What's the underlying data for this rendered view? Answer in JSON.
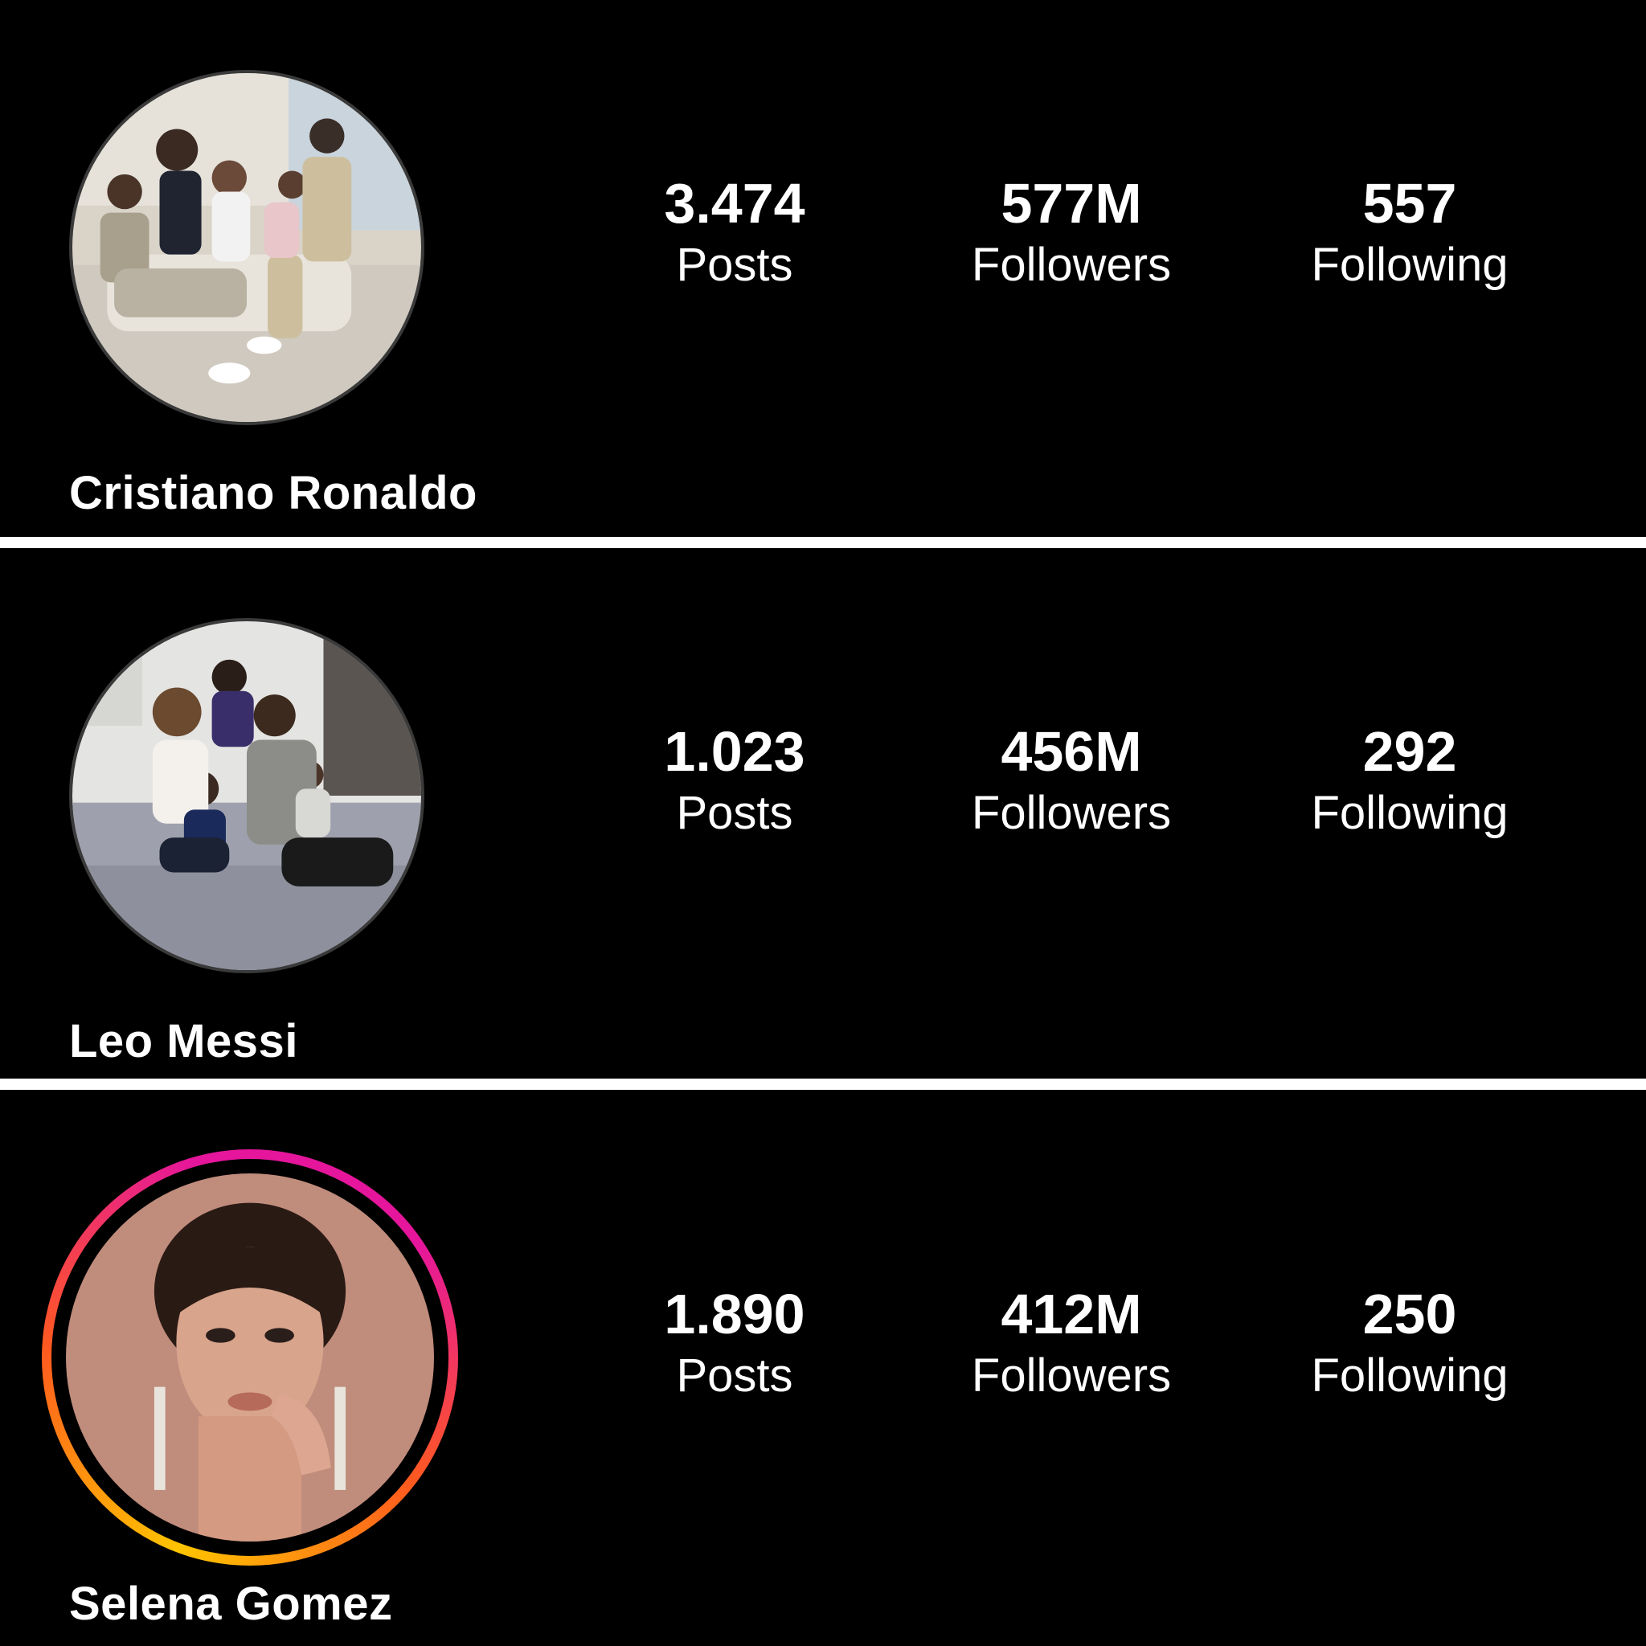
{
  "colors": {
    "background": "#000000",
    "text": "#ffffff",
    "divider": "#ffffff",
    "story_ring_start": "#ffc400",
    "story_ring_mid": "#ff5a1f",
    "story_ring_end": "#e5169c"
  },
  "profiles": [
    {
      "name": "Cristiano Ronaldo",
      "avatar_icon": "family-photo-avatar",
      "has_story_ring": false,
      "stats": {
        "posts_value": "3.474",
        "posts_label": "Posts",
        "followers_value": "577M",
        "followers_label": "Followers",
        "following_value": "557",
        "following_label": "Following"
      }
    },
    {
      "name": "Leo Messi",
      "avatar_icon": "family-photo-avatar",
      "has_story_ring": false,
      "stats": {
        "posts_value": "1.023",
        "posts_label": "Posts",
        "followers_value": "456M",
        "followers_label": "Followers",
        "following_value": "292",
        "following_label": "Following"
      }
    },
    {
      "name": "Selena Gomez",
      "avatar_icon": "portrait-photo-avatar",
      "has_story_ring": true,
      "stats": {
        "posts_value": "1.890",
        "posts_label": "Posts",
        "followers_value": "412M",
        "followers_label": "Followers",
        "following_value": "250",
        "following_label": "Following"
      }
    }
  ]
}
